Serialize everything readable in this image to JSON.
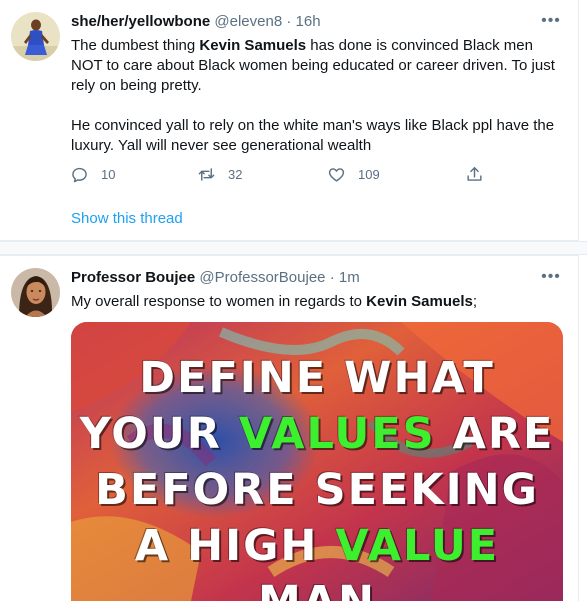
{
  "tweets": [
    {
      "display_name": "she/her/yellowbone",
      "handle": "@eleven8",
      "separator": "·",
      "time": "16h",
      "more_icon": "•••",
      "text": {
        "p1_pre": "The dumbest thing ",
        "p1_bold": "Kevin Samuels",
        "p1_post": " has done is convinced Black men NOT to care about Black women being educated or career driven. To just rely on being pretty.",
        "p2": "He convinced yall to rely on the white man's ways like Black ppl have the luxury. Yall will never see generational wealth"
      },
      "actions": {
        "reply_count": "10",
        "retweet_count": "32",
        "like_count": "109",
        "reply_icon": "reply-icon",
        "retweet_icon": "retweet-icon",
        "like_icon": "heart-icon",
        "share_icon": "share-icon"
      },
      "show_thread": "Show this thread"
    },
    {
      "display_name": "Professor Boujee",
      "handle": "@ProfessorBoujee",
      "separator": "·",
      "time": "1m",
      "more_icon": "•••",
      "text": {
        "pre": "My overall response to women in regards to ",
        "bold": "Kevin Samuels",
        "post": ";"
      },
      "image": {
        "line1": "DEFINE WHAT",
        "line2_a": "YOUR ",
        "line2_b": "VALUES",
        "line2_c": " ARE",
        "line3": "BEFORE SEEKING",
        "line4_a": "A HIGH ",
        "line4_b": "VALUE",
        "line5": "MAN"
      }
    }
  ],
  "colors": {
    "link": "#1da1f2",
    "secondary_text": "#5b7083",
    "image_highlight": "#3df02f"
  }
}
